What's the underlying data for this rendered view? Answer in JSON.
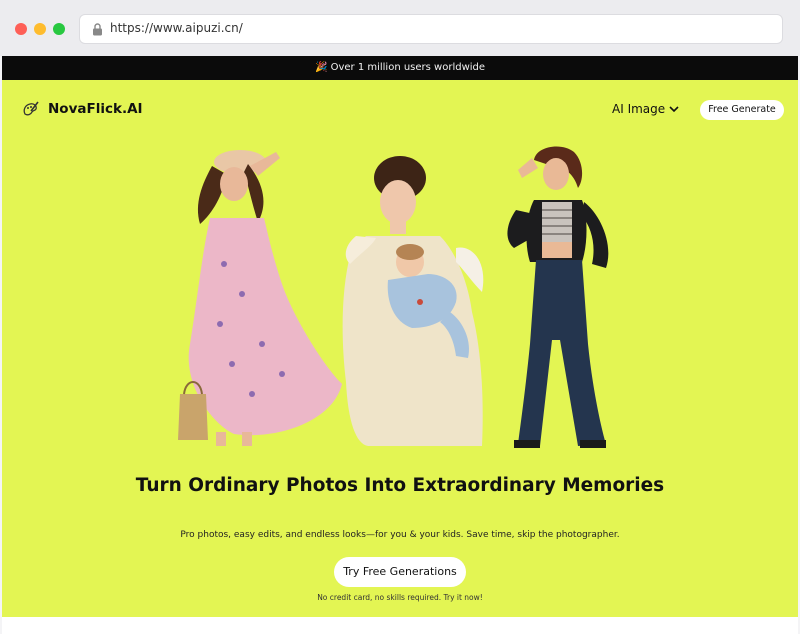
{
  "browser": {
    "url": "https://www.aipuzi.cn/"
  },
  "banner": {
    "text": "🎉 Over 1 million users worldwide"
  },
  "header": {
    "logo_text": "NovaFlick.AI",
    "nav_ai_image": "AI Image",
    "free_generate": "Free Generate"
  },
  "hero": {
    "headline": "Turn Ordinary Photos Into Extraordinary Memories",
    "subline": "Pro photos, easy edits, and endless looks—for you & your kids. Save time, skip the photographer.",
    "cta": "Try Free Generations",
    "note": "No credit card, no skills required. Try it now!"
  },
  "colors": {
    "page_bg": "#e3f553",
    "banner_bg": "#0b0b0b"
  }
}
